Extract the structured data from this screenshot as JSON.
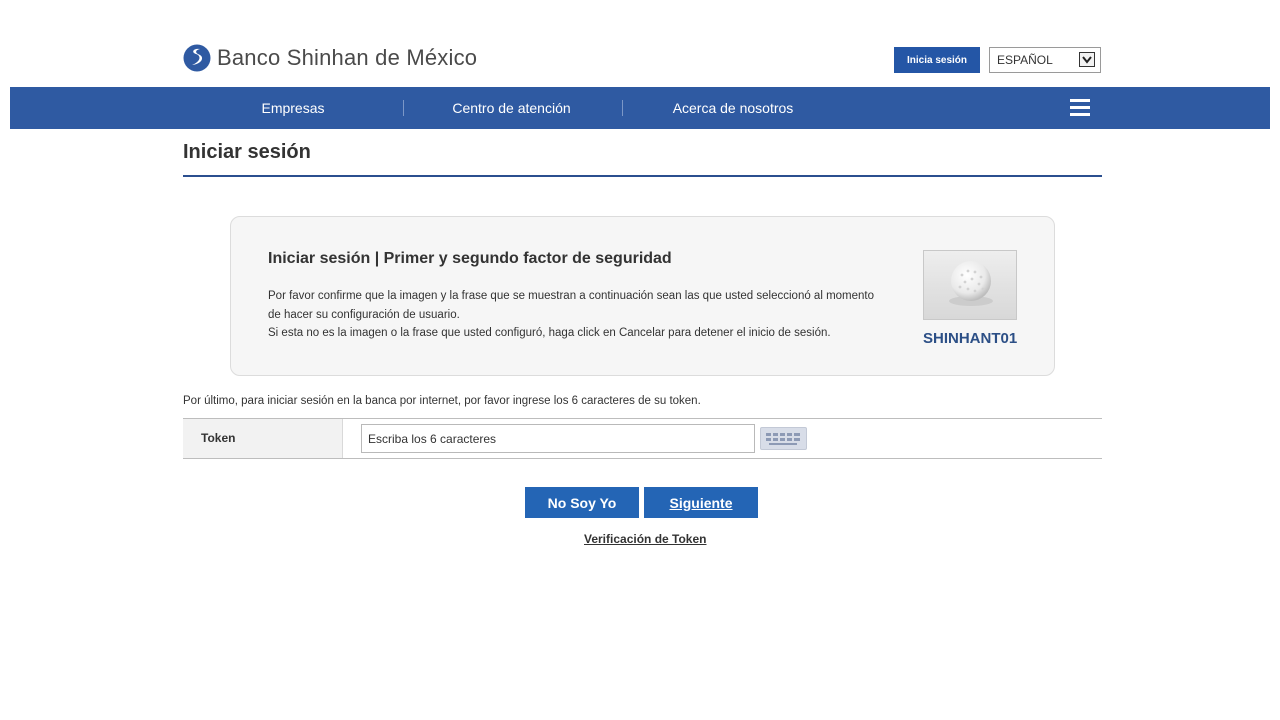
{
  "header": {
    "brand_name": "Banco Shinhan de México",
    "login_button_label": "Inicia sesión",
    "language_selected": "ESPAÑOL"
  },
  "nav": {
    "items": [
      {
        "label": "Empresas"
      },
      {
        "label": "Centro de atención"
      },
      {
        "label": "Acerca de nosotros"
      }
    ],
    "menu_icon": "hamburger-icon"
  },
  "page": {
    "title": "Iniciar sesión"
  },
  "security": {
    "heading": "Iniciar sesión | Primer y segundo factor de seguridad",
    "line1": "Por favor confirme que la imagen y la frase que se muestran a continuación sean las que usted seleccionó al momento de hacer su configuración de usuario.",
    "line2": "Si esta no es la imagen o la frase que usted configuró, haga click en Cancelar para detener el inicio de sesión.",
    "image_icon": "golf-ball-image",
    "phrase": "SHINHANT01"
  },
  "token": {
    "instruction": "Por último, para iniciar sesión en la banca por internet, por favor ingrese los 6 caracteres de su token.",
    "label": "Token",
    "placeholder": "Escriba los 6 caracteres",
    "value": "",
    "keypad_icon": "keyboard-icon"
  },
  "actions": {
    "not_me_label": "No Soy Yo",
    "next_label": "Siguiente",
    "verify_link_label": "Verificación de Token"
  },
  "colors": {
    "brand_blue": "#2f5aa2",
    "button_blue": "#2465b5",
    "phrase_blue": "#2c4f86"
  }
}
